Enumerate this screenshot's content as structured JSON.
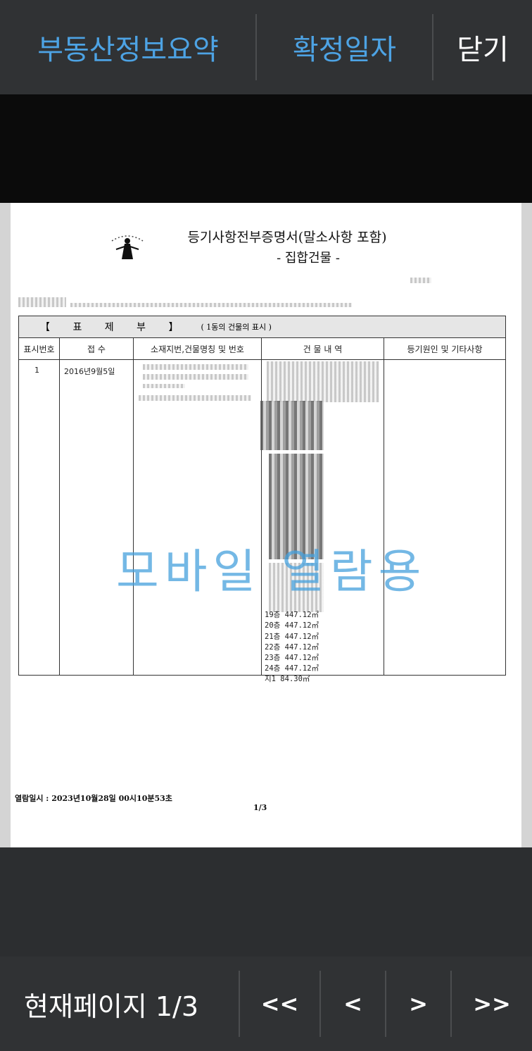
{
  "top_bar": {
    "summary_label": "부동산정보요약",
    "confirm_date_label": "확정일자",
    "close_label": "닫기"
  },
  "document": {
    "title": "등기사항전부증명서(말소사항 포함)",
    "subtitle": "- 집합건물 -",
    "section_title": "【 표 제 부 】",
    "section_note": "( 1동의 건물의 표시 )",
    "columns": [
      "표시번호",
      "접 수",
      "소재지번,건물명칭 및 번호",
      "건 물 내 역",
      "등기원인 및 기타사항"
    ],
    "row": {
      "number": "1",
      "date": "2016년9월5일"
    },
    "floors": [
      "19층 447.12㎡",
      "20층 447.12㎡",
      "21층 447.12㎡",
      "22층 447.12㎡",
      "23층 447.12㎡",
      "24층 447.12㎡",
      "지1 84.30㎡"
    ],
    "watermark": "모바일 열람용",
    "view_datetime": "열람일시 : 2023년10월28일 00시10분53초",
    "page_num": "1/3"
  },
  "bottom_bar": {
    "current_page_label": "현재페이지 1/3",
    "first_label": "<<",
    "prev_label": "<",
    "next_label": ">",
    "last_label": ">>"
  },
  "colors": {
    "accent": "#4da3e4",
    "bar_bg": "#303234"
  }
}
